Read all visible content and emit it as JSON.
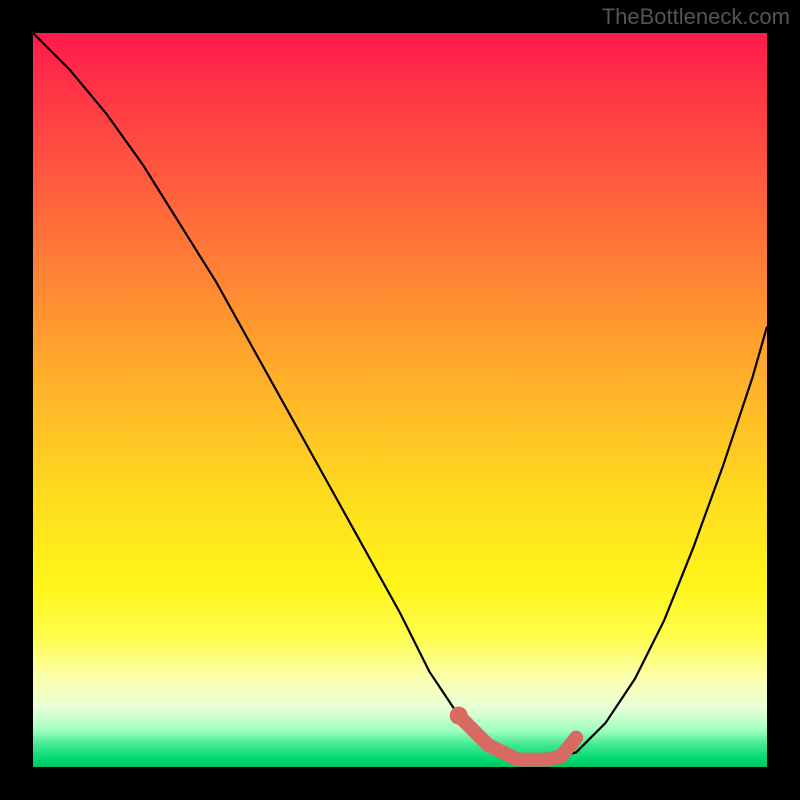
{
  "attribution": "TheBottleneck.com",
  "chart_data": {
    "type": "line",
    "title": "",
    "xlabel": "",
    "ylabel": "",
    "xlim": [
      0,
      100
    ],
    "ylim": [
      0,
      100
    ],
    "series": [
      {
        "name": "bottleneck-curve",
        "x": [
          0,
          5,
          10,
          15,
          20,
          25,
          30,
          35,
          40,
          45,
          50,
          54,
          58,
          62,
          66,
          70,
          74,
          78,
          82,
          86,
          90,
          94,
          98,
          100
        ],
        "values": [
          100,
          95,
          89,
          82,
          74,
          66,
          57,
          48,
          39,
          30,
          21,
          13,
          7,
          3,
          1,
          1,
          2,
          6,
          12,
          20,
          30,
          41,
          53,
          60
        ]
      }
    ],
    "highlight": {
      "name": "optimal-range",
      "x": [
        58,
        62,
        66,
        70,
        72,
        74
      ],
      "values": [
        7,
        3,
        1,
        1,
        1.5,
        4
      ],
      "color": "#d86a62"
    },
    "marker": {
      "x": 58,
      "y": 7,
      "color": "#d86a62"
    },
    "background_gradient": {
      "top": "#ff1a4a",
      "middle": "#ffe01e",
      "bottom": "#00d870"
    }
  }
}
